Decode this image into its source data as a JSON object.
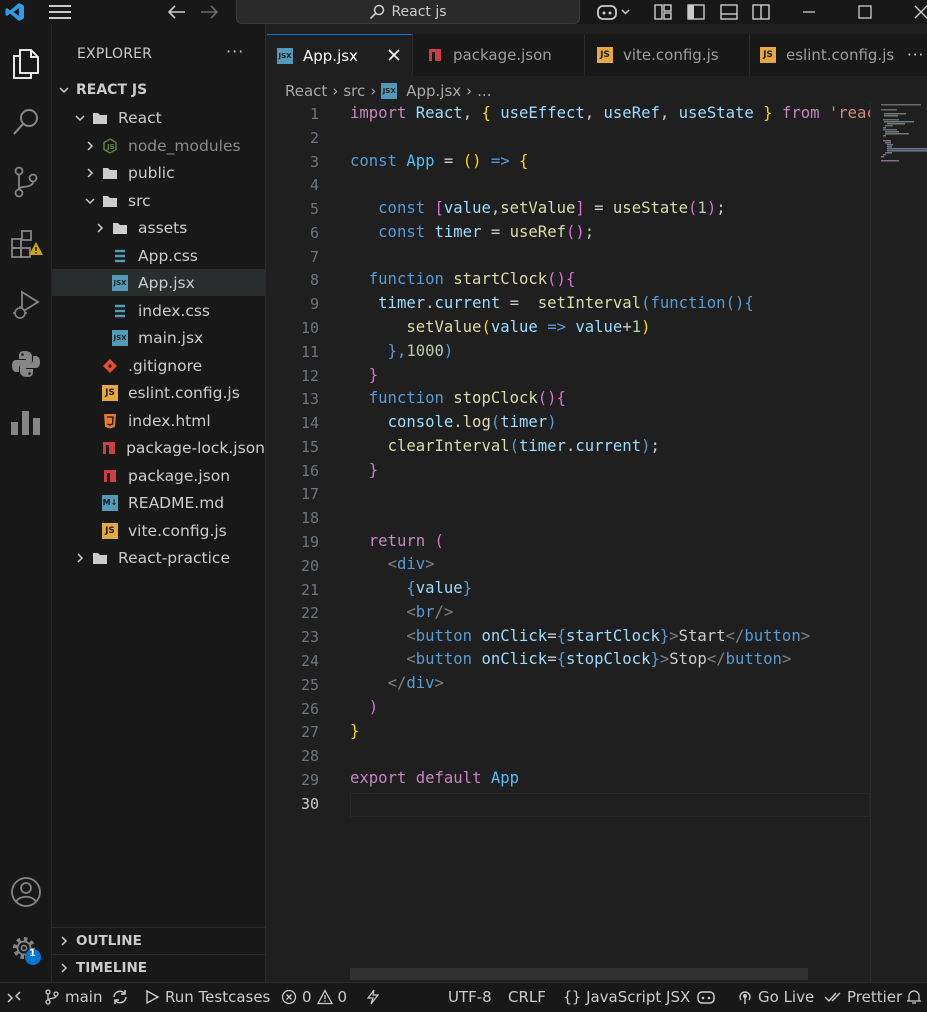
{
  "titlebar": {
    "search_text": "React js"
  },
  "sidebar": {
    "title": "EXPLORER",
    "more": "···",
    "root": "REACT JS",
    "items": [
      {
        "label": "React"
      },
      {
        "label": "node_modules"
      },
      {
        "label": "public"
      },
      {
        "label": "src"
      },
      {
        "label": "assets"
      },
      {
        "label": "App.css"
      },
      {
        "label": "App.jsx"
      },
      {
        "label": "index.css"
      },
      {
        "label": "main.jsx"
      },
      {
        "label": ".gitignore"
      },
      {
        "label": "eslint.config.js"
      },
      {
        "label": "index.html"
      },
      {
        "label": "package-lock.json"
      },
      {
        "label": "package.json"
      },
      {
        "label": "README.md"
      },
      {
        "label": "vite.config.js"
      },
      {
        "label": "React-practice"
      }
    ],
    "outline": "OUTLINE",
    "timeline": "TIMELINE"
  },
  "tabs": [
    {
      "label": "App.jsx"
    },
    {
      "label": "package.json"
    },
    {
      "label": "vite.config.js"
    },
    {
      "label": "eslint.config.js"
    }
  ],
  "tab_more": "···",
  "breadcrumb": [
    "React",
    "src",
    "App.jsx",
    "..."
  ],
  "editor": {
    "line_numbers": [
      "1",
      "2",
      "3",
      "4",
      "5",
      "6",
      "7",
      "8",
      "9",
      "10",
      "11",
      "12",
      "13",
      "14",
      "15",
      "16",
      "17",
      "18",
      "19",
      "20",
      "21",
      "22",
      "23",
      "24",
      "25",
      "26",
      "27",
      "28",
      "29",
      "30"
    ]
  },
  "statusbar": {
    "branch": "main",
    "run_testcases": "Run Testcases",
    "errors": "0",
    "warnings": "0",
    "encoding": "UTF-8",
    "eol": "CRLF",
    "language": "JavaScript JSX",
    "golive": "Go Live",
    "prettier": "Prettier"
  },
  "badges": {
    "settings": "1"
  },
  "colors": {
    "accent": "#0078d4",
    "keyword": "#c586c0",
    "function": "#dcdcaa",
    "variable": "#9cdcfe"
  }
}
